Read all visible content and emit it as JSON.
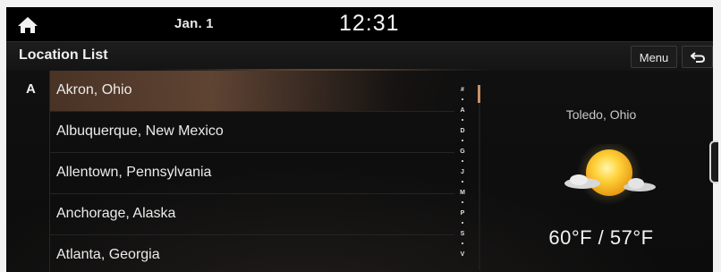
{
  "status_bar": {
    "home_icon": "home-icon",
    "date": "Jan. 1",
    "time": "12:31"
  },
  "header": {
    "title": "Location List",
    "menu_label": "Menu",
    "back_icon": "back-arrow-icon"
  },
  "list": {
    "section_letter": "A",
    "items": [
      {
        "label": "Akron, Ohio",
        "selected": true
      },
      {
        "label": "Albuquerque, New Mexico",
        "selected": false
      },
      {
        "label": "Allentown, Pennsylvania",
        "selected": false
      },
      {
        "label": "Anchorage, Alaska",
        "selected": false
      },
      {
        "label": "Atlanta, Georgia",
        "selected": false
      }
    ]
  },
  "index_bar": [
    "#",
    "A",
    "D",
    "G",
    "J",
    "M",
    "P",
    "S",
    "V"
  ],
  "weather": {
    "city": "Toledo, Ohio",
    "icon": "partly-sunny-icon",
    "temperature": "60°F / 57°F"
  },
  "colors": {
    "accent": "#c98f6a",
    "background": "#0c0c0c",
    "text": "#ececec"
  }
}
